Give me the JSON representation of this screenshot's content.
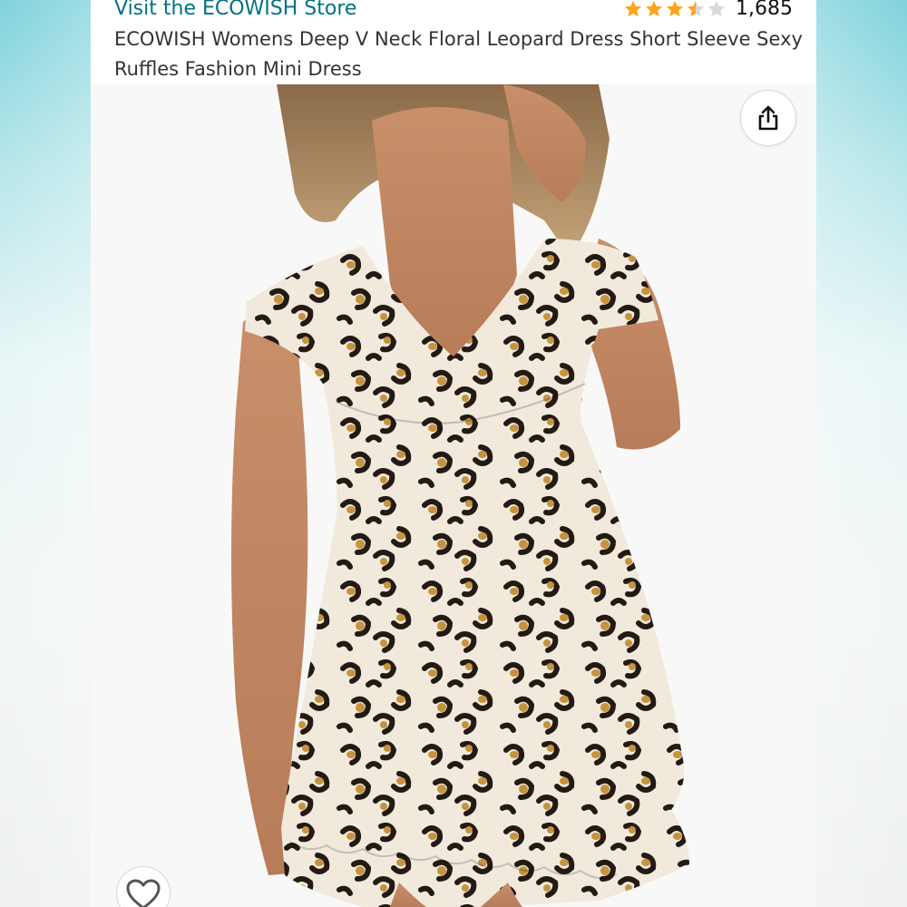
{
  "store": {
    "link_text": "Visit the ECOWISH Store"
  },
  "rating": {
    "stars": 3.5,
    "count": "1,685"
  },
  "product": {
    "title": "ECOWISH Womens Deep V Neck Floral Leopard Dress Short Sleeve Sexy Ruffles Fashion Mini Dress"
  },
  "icons": {
    "share": "share-icon",
    "wishlist": "heart-icon"
  },
  "colors": {
    "link": "#007185",
    "star": "#FFA41C",
    "star_empty": "#D5D9D9",
    "title_text": "#333333"
  }
}
